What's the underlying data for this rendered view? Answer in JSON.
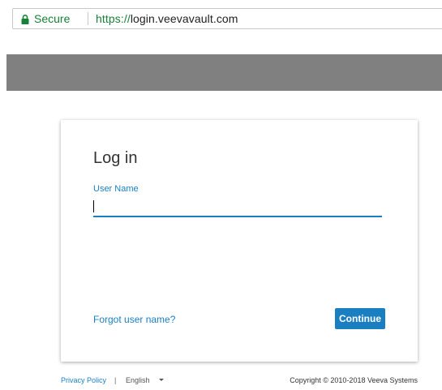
{
  "browser": {
    "security_label": "Secure",
    "url_scheme": "https://",
    "url_host": "login.veevavault.com",
    "secure_color": "#188038"
  },
  "login": {
    "title": "Log in",
    "username_label": "User Name",
    "username_value": "",
    "forgot_link": "Forgot user name?",
    "continue_label": "Continue",
    "accent_color": "#1a7fc1"
  },
  "footer": {
    "privacy_link": "Privacy Policy",
    "separator": "|",
    "language": "English",
    "copyright": "Copyright © 2010-2018 Veeva Systems"
  },
  "icons": [
    "lock-icon",
    "chevron-down-icon"
  ]
}
